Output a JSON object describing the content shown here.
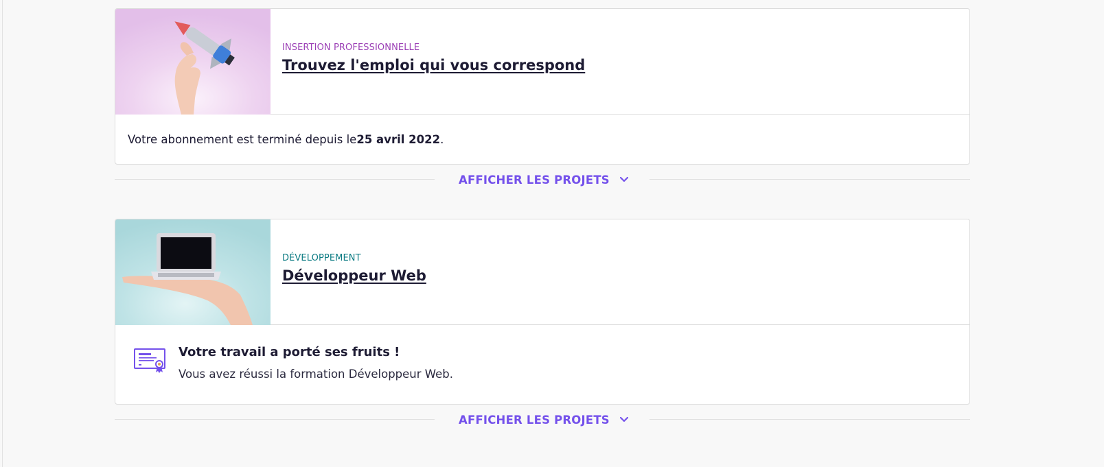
{
  "courses": [
    {
      "category": "INSERTION PROFESSIONNELLE",
      "category_color": "#9b3fb5",
      "title": "Trouvez l'emploi qui vous correspond",
      "image_icon": "rocket-in-hand-illustration",
      "status_prefix": "Votre abonnement est terminé depuis le ",
      "status_date": "25 avril 2022",
      "status_suffix": ".",
      "show_projects_label": "AFFICHER LES PROJETS"
    },
    {
      "category": "DÉVELOPPEMENT",
      "category_color": "#0c7b83",
      "title": "Développeur Web",
      "image_icon": "laptop-in-hand-illustration",
      "cert_icon": "certificate-icon",
      "cert_title": "Votre travail a porté ses fruits !",
      "cert_desc": "Vous avez réussi la formation Développeur Web.",
      "show_projects_label": "AFFICHER LES PROJETS"
    }
  ],
  "colors": {
    "accent": "#7451eb",
    "text": "#1d1b33",
    "border": "#dcdcdc",
    "background": "#f8f8f8"
  }
}
